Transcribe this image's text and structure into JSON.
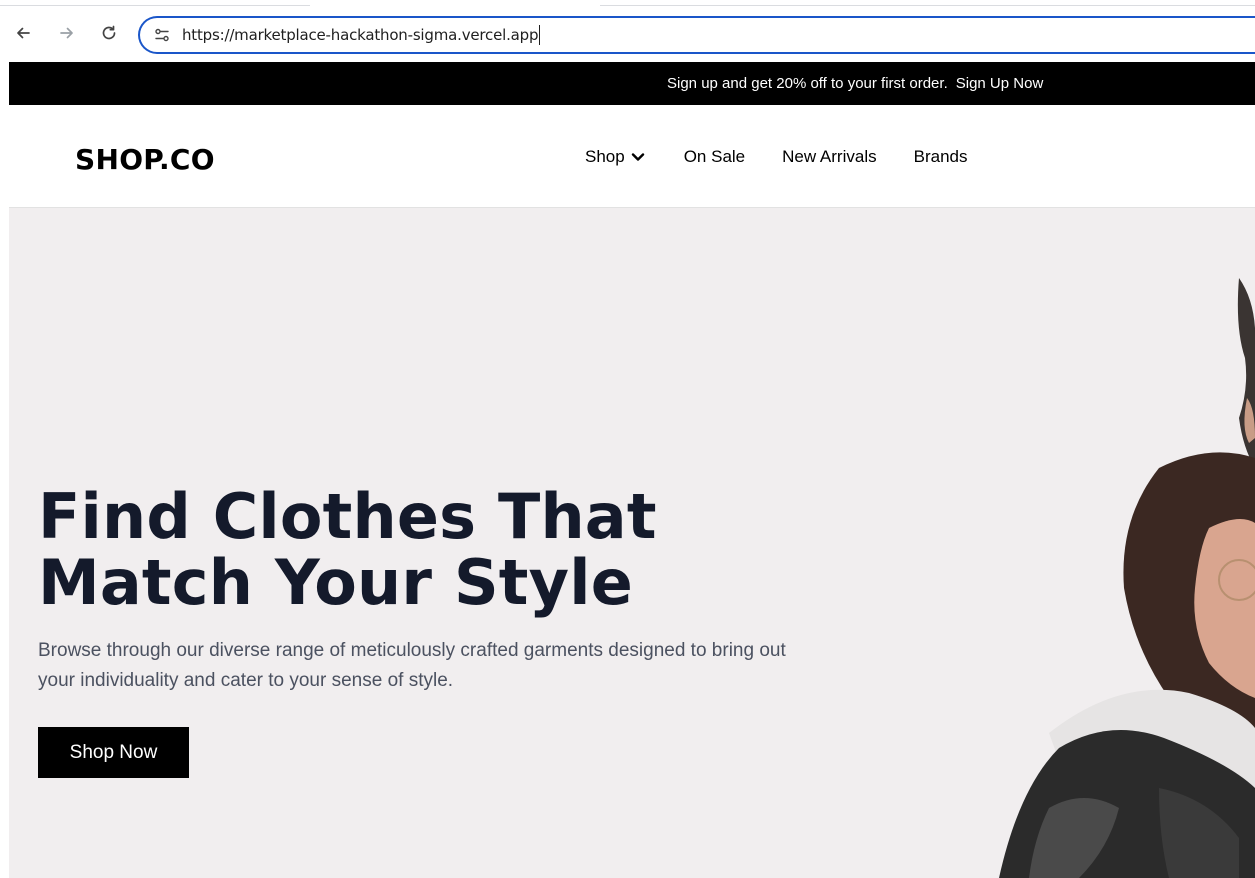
{
  "browser": {
    "url": "https://marketplace-hackathon-sigma.vercel.app",
    "back_icon": "back-arrow-icon",
    "forward_icon": "forward-arrow-icon",
    "reload_icon": "reload-icon",
    "site_info_icon": "site-info-icon"
  },
  "promo": {
    "text": "Sign up and get 20% off to your first order.",
    "link": "Sign Up Now"
  },
  "header": {
    "logo": "SHOP.CO",
    "nav": [
      {
        "label": "Shop",
        "has_dropdown": true
      },
      {
        "label": "On Sale"
      },
      {
        "label": "New Arrivals"
      },
      {
        "label": "Brands"
      }
    ]
  },
  "hero": {
    "title_line1": "Find Clothes That",
    "title_line2": "Match Your Style",
    "subtitle": "Browse through our diverse range of meticulously crafted garments designed to bring out your individuality and cater to your sense of style.",
    "cta": "Shop Now"
  },
  "colors": {
    "promo_bg": "#000000",
    "hero_bg": "#f1eeef",
    "title": "#141a2b",
    "address_border": "#1a56c9"
  }
}
